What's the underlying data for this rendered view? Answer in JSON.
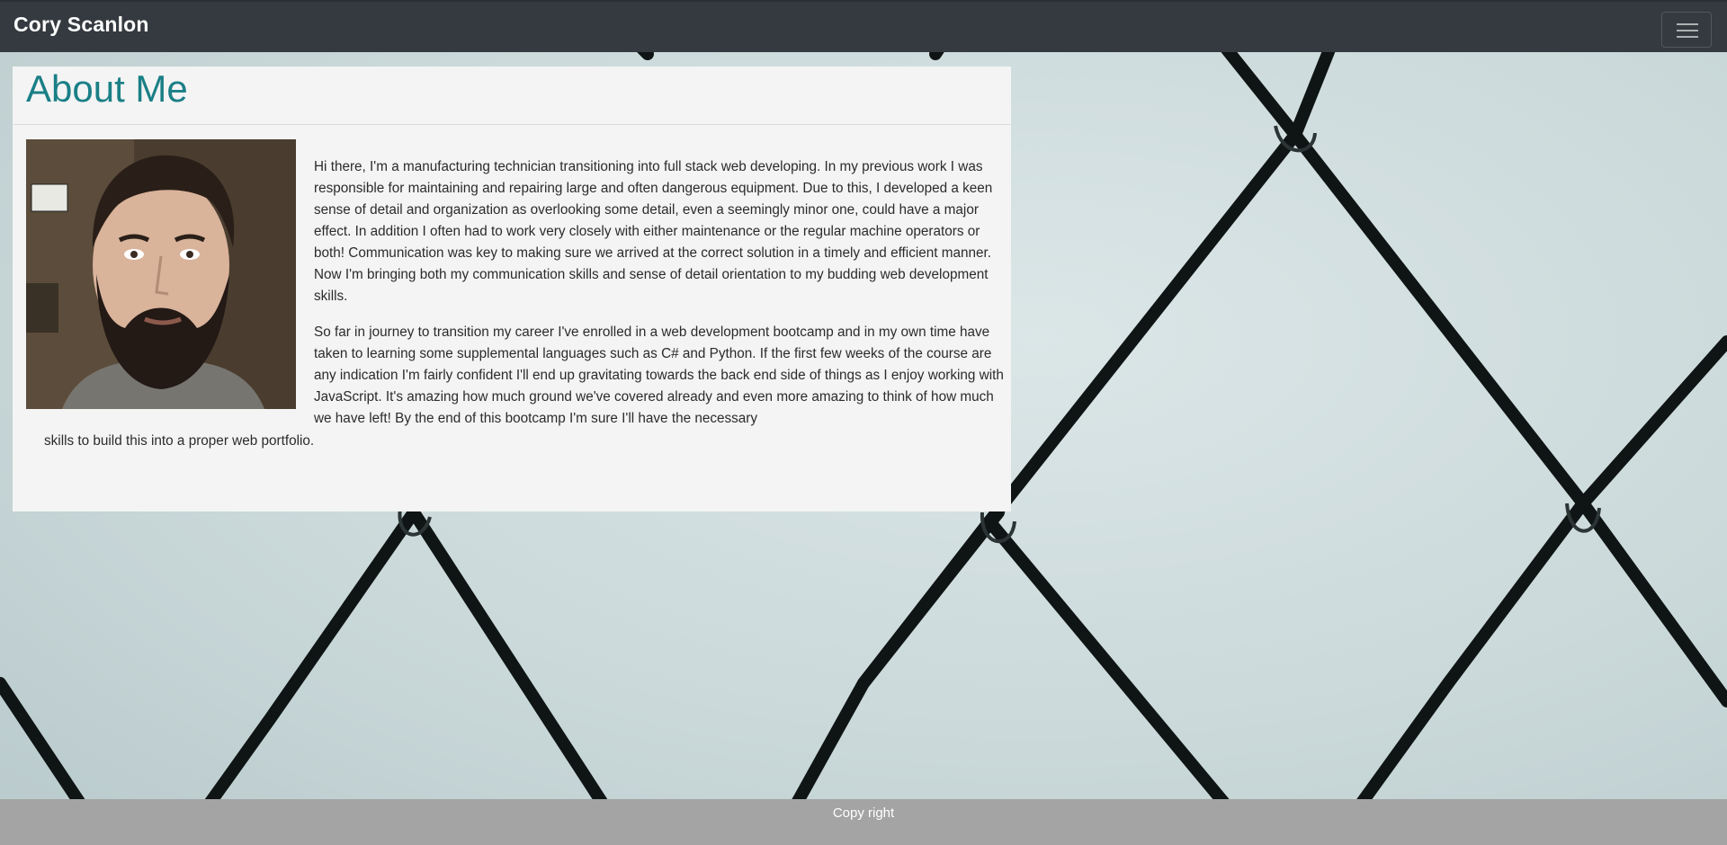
{
  "navbar": {
    "brand": "Cory Scanlon",
    "toggler_icon": "hamburger-menu-icon"
  },
  "about": {
    "title": "About Me",
    "paragraph_1": "Hi there, I'm a manufacturing technician transitioning into full stack web developing. In my previous work I was responsible for maintaining and repairing large and often dangerous equipment. Due to this, I developed a keen sense of detail and organization as overlooking some detail, even a seemingly minor one, could have a major effect. In addition I often had to work very closely with either maintenance or the regular machine operators or both! Communication was key to making sure we arrived at the correct solution in a timely and efficient manner. Now I'm bringing both my communication skills and sense of detail orientation to my budding web development skills.",
    "paragraph_2": "So far in journey to transition my career I've enrolled in a web development bootcamp and in my own time have taken to learning some supplemental languages such as C# and Python. If the first few weeks of the course are any indication I'm fairly confident I'll end up gravitating towards the back end side of things as I enjoy working with JavaScript. It's amazing how much ground we've covered already and even more amazing to think of how much we have left! By the end of this bootcamp I'm sure I'll have the necessary",
    "paragraph_2_tail": "skills to build this into a proper web portfolio."
  },
  "footer": {
    "text": "Copy right"
  },
  "colors": {
    "navbar": "#343a40",
    "title": "#1a7f86",
    "card": "#f4f4f4",
    "footer": "#a4a4a4"
  }
}
